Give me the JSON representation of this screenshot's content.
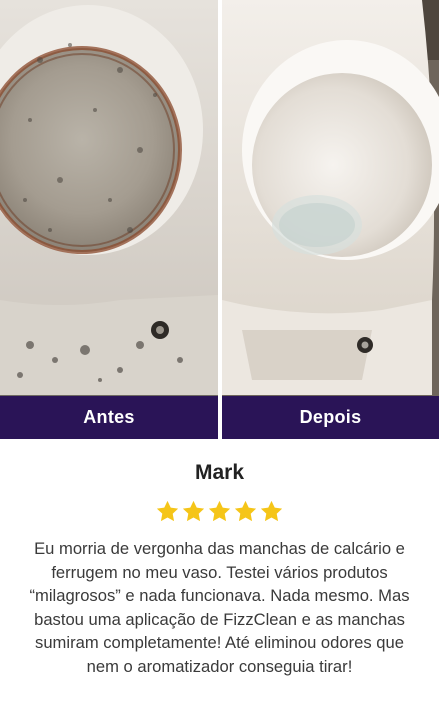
{
  "before_after": {
    "before_label": "Antes",
    "after_label": "Depois",
    "label_bar_color": "#2a1457"
  },
  "review": {
    "reviewer_name": "Mark",
    "rating": 5,
    "max_rating": 5,
    "star_color": "#f5c518",
    "text": "Eu morria de vergonha das manchas de calcário e ferrugem no meu vaso. Testei vários produtos “milagrosos” e nada funcionava. Nada mesmo. Mas bastou uma aplicação de FizzClean e as manchas sumiram completamente! Até eliminou odores que nem o aromatizador conseguia tirar!"
  },
  "icons": {
    "star": "star-icon"
  }
}
